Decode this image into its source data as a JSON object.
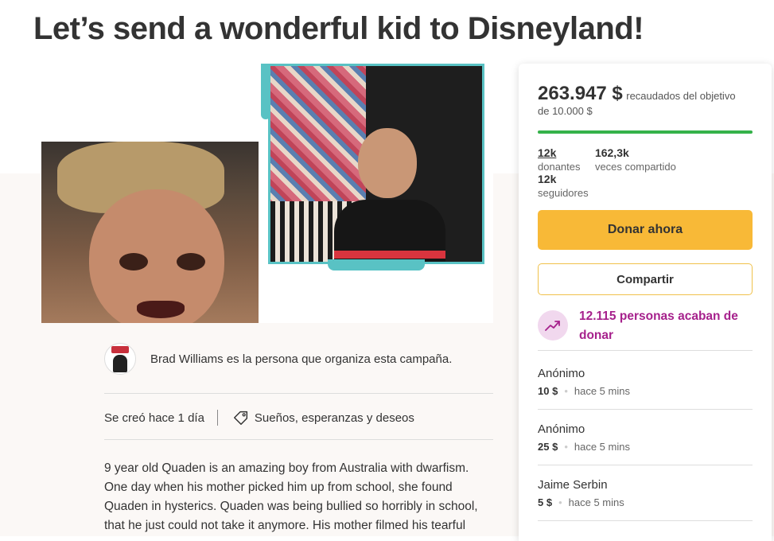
{
  "page": {
    "title": "Let’s send a wonderful kid to Disneyland!"
  },
  "organizer": {
    "text": "Brad Williams es la persona que organiza esta campaña.",
    "avatar_label": "BRAD WILLIAMS"
  },
  "meta": {
    "created": "Se creó hace 1 día",
    "category": "Sueños, esperanzas y deseos"
  },
  "story": {
    "text": "9 year old Quaden is an amazing boy from Australia with dwarfism. One day when his mother picked him up from school, she found Quaden in hysterics. Quaden was being bullied so horribly in school, that he just could not take it anymore. His mother filmed his tearful"
  },
  "donation": {
    "raised": "263.947 $",
    "raised_suffix": "recaudados del objetivo",
    "goal": "de 10.000 $",
    "progress_fraction": 1.0,
    "stats": [
      {
        "num": "12k",
        "label": "donantes"
      },
      {
        "num": "162,3k",
        "label": "veces compartido"
      },
      {
        "num": "12k",
        "label": "seguidores"
      }
    ],
    "donate_button": "Donar ahora",
    "share_button": "Compartir",
    "trend_text": "12.115 personas acaban de donar",
    "recent": [
      {
        "name": "Anónimo",
        "amount": "10 $",
        "time": "hace 5 mins"
      },
      {
        "name": "Anónimo",
        "amount": "25 $",
        "time": "hace 5 mins"
      },
      {
        "name": "Jaime Serbin",
        "amount": "5 $",
        "time": "hace 5 mins"
      }
    ]
  },
  "colors": {
    "accent_yellow": "#f8b937",
    "progress_green": "#35b24a",
    "trend_purple": "#a6218c",
    "photo_frame_teal": "#59c2c4"
  }
}
